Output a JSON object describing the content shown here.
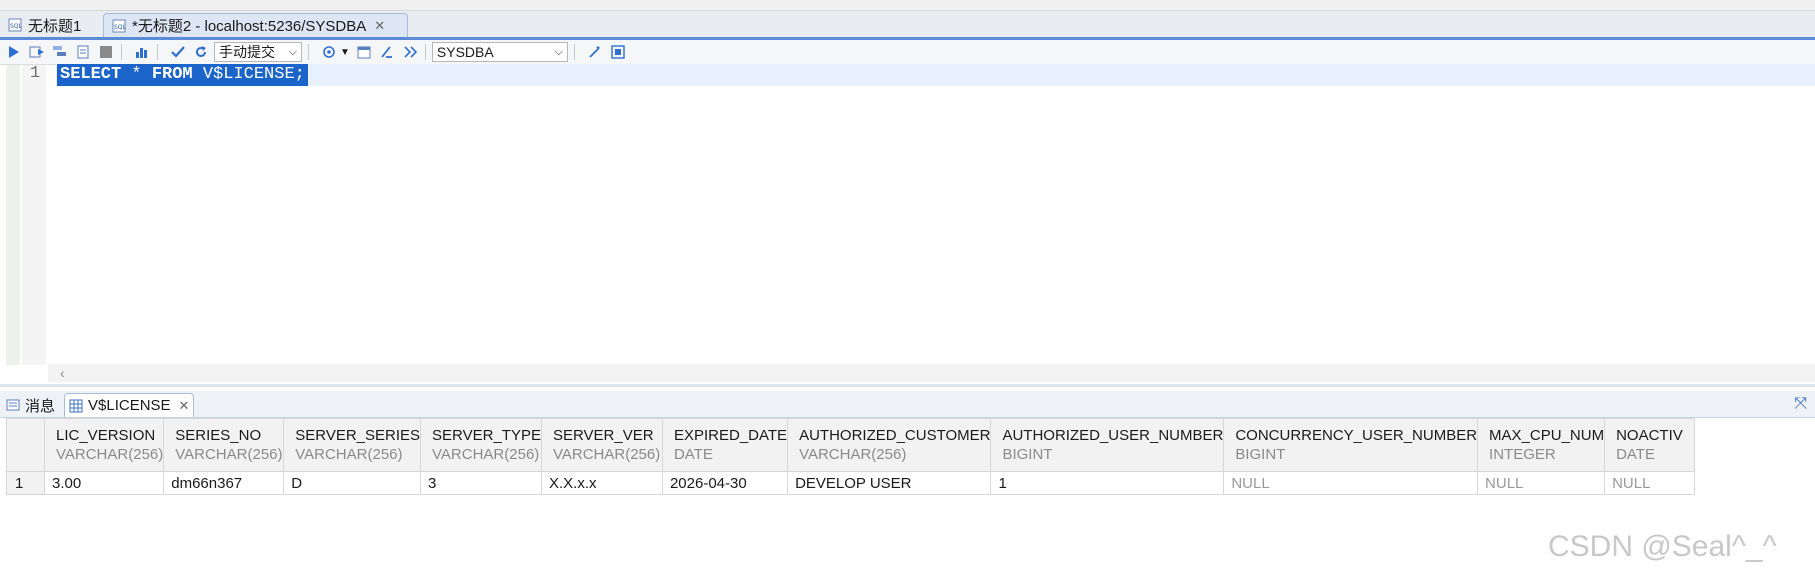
{
  "editor_tabs": [
    {
      "label": "无标题1"
    },
    {
      "label": "*无标题2 - localhost:5236/SYSDBA"
    }
  ],
  "toolbar": {
    "commit_mode": "手动提交",
    "schema": "SYSDBA"
  },
  "editor": {
    "line_number": "1",
    "keyword_select": "SELECT",
    "star": " * ",
    "keyword_from": "FROM",
    "table": " V$LICENSE;"
  },
  "result_tabs": [
    {
      "label": "消息"
    },
    {
      "label": "V$LICENSE"
    }
  ],
  "columns": [
    {
      "name": "LIC_VERSION",
      "type": "VARCHAR(256)"
    },
    {
      "name": "SERIES_NO",
      "type": "VARCHAR(256)"
    },
    {
      "name": "SERVER_SERIES",
      "type": "VARCHAR(256)"
    },
    {
      "name": "SERVER_TYPE",
      "type": "VARCHAR(256)"
    },
    {
      "name": "SERVER_VER",
      "type": "VARCHAR(256)"
    },
    {
      "name": "EXPIRED_DATE",
      "type": "DATE"
    },
    {
      "name": "AUTHORIZED_CUSTOMER",
      "type": "VARCHAR(256)"
    },
    {
      "name": "AUTHORIZED_USER_NUMBER",
      "type": "BIGINT"
    },
    {
      "name": "CONCURRENCY_USER_NUMBER",
      "type": "BIGINT"
    },
    {
      "name": "MAX_CPU_NUM",
      "type": "INTEGER"
    },
    {
      "name": "NOACTIV",
      "type": "DATE"
    }
  ],
  "rows": [
    {
      "row_num": "1",
      "cells": [
        "3.00",
        "dm66n367",
        "D",
        "3",
        "X.X.x.x",
        "2026-04-30",
        "DEVELOP USER",
        "1",
        "NULL",
        "NULL",
        "NULL"
      ]
    }
  ],
  "watermark": "CSDN @Seal^_^",
  "colors": {
    "accent": "#1b64c9",
    "tab_border": "#5b8ad6"
  }
}
